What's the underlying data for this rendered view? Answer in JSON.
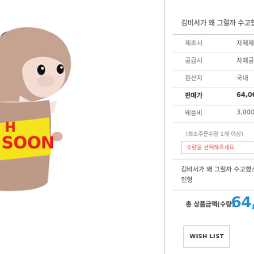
{
  "product_image": {
    "sticker_line1": "H",
    "sticker_line2": "SOON"
  },
  "product": {
    "title": "김비서가 왜 그럴까 수고했",
    "specs": [
      {
        "label": "제조사",
        "value": "자체제"
      },
      {
        "label": "공급사",
        "value": "자체공"
      },
      {
        "label": "원산지",
        "value": "국내"
      },
      {
        "label": "판매가",
        "value": "64,00"
      },
      {
        "label": "배송비",
        "value": "3,000"
      }
    ],
    "min_quantity_note": "(최소주문수량 1개 이상)",
    "option_placeholder": "수량을 선택해주세요",
    "description_lines": [
      "김비서가 왜 그럴까 수고했소 뜻",
      "인형"
    ],
    "total_label": "총 상품금액(수량)",
    "total_price": "64,0",
    "wishlist_label": "WISH LIST"
  },
  "colors": {
    "sticker_yellow": "#f5e31b",
    "sticker_red": "#e8231a",
    "price_blue": "#2d8fd0"
  }
}
